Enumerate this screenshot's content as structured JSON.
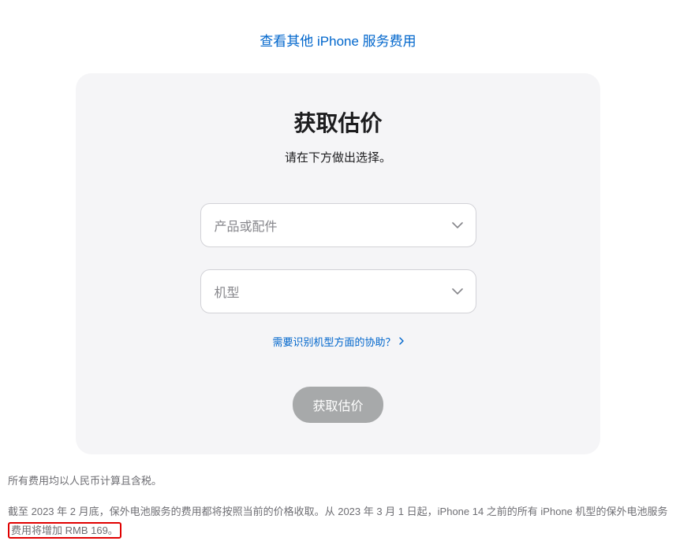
{
  "topLink": "查看其他 iPhone 服务费用",
  "card": {
    "title": "获取估价",
    "subtitle": "请在下方做出选择。",
    "select1_placeholder": "产品或配件",
    "select2_placeholder": "机型",
    "helpLink": "需要识别机型方面的协助？",
    "submitLabel": "获取估价"
  },
  "foot": {
    "line1": "所有费用均以人民币计算且含税。",
    "line2_pre": "截至 2023 年 2 月底，保外电池服务的费用都将按照当前的价格收取。从 2023 年 3 月 1 日起，iPhone 14 之前的所有 iPhone 机型的保外电池服务",
    "line2_hl": "费用将增加 RMB 169。"
  }
}
